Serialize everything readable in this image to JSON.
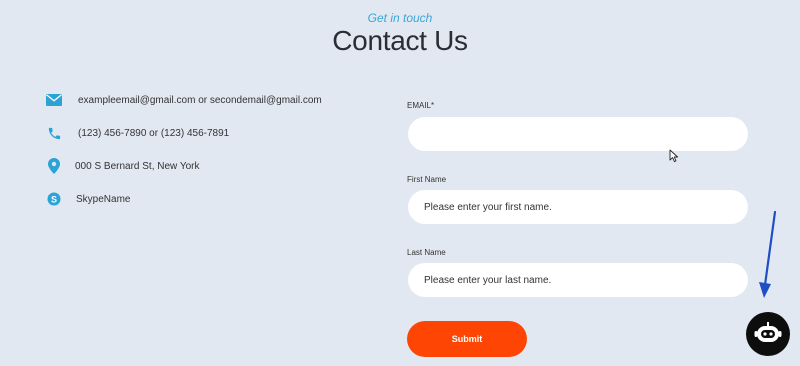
{
  "header": {
    "eyebrow": "Get in touch",
    "title": "Contact Us"
  },
  "contact": {
    "email": "exampleemail@gmail.com or secondemail@gmail.com",
    "phone": "(123) 456-7890 or (123) 456-7891",
    "address": "000 S Bernard St, New York",
    "skype": "SkypeName"
  },
  "form": {
    "email_label": "EMAIL*",
    "email_value": "",
    "email_placeholder": "",
    "first_name_label": "First Name",
    "first_name_placeholder": "Please enter your first name.",
    "last_name_label": "Last Name",
    "last_name_placeholder": "Please enter your last name.",
    "submit_label": "Submit"
  },
  "colors": {
    "background": "#e2e8f1",
    "accent": "#3aa7d9",
    "submit": "#ff4503",
    "annotation_arrow": "#1f4fc7",
    "chat_widget": "#0d0d0d"
  },
  "icons": {
    "email": "envelope-icon",
    "phone": "phone-icon",
    "address": "map-pin-icon",
    "skype": "skype-icon",
    "chat": "chatbot-icon",
    "cursor": "mouse-cursor-icon",
    "arrow": "annotation-arrow-icon"
  }
}
